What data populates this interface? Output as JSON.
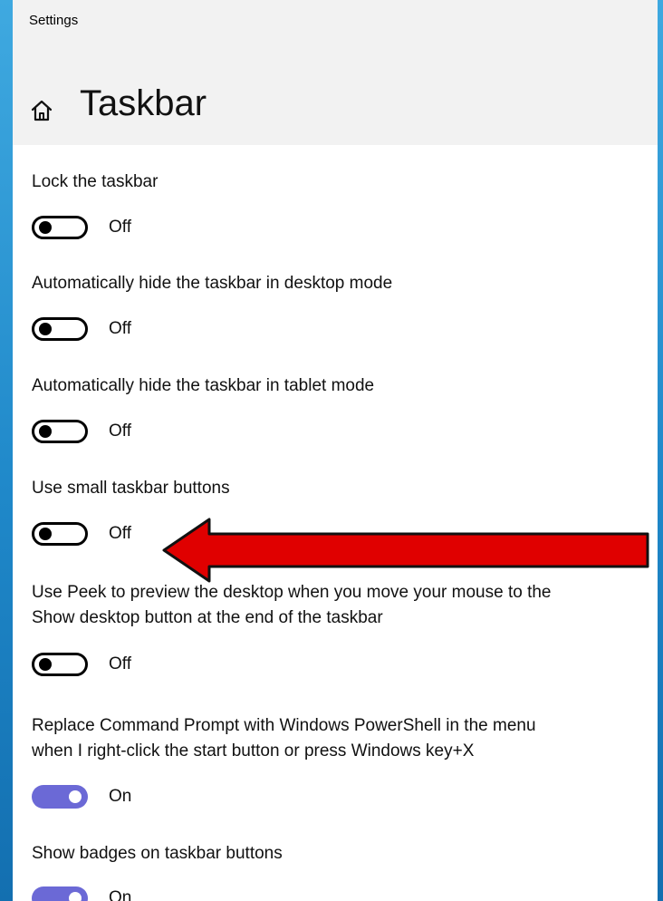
{
  "window": {
    "app_title": "Settings",
    "page_title": "Taskbar"
  },
  "header": {
    "home_icon": "home-icon"
  },
  "settings": [
    {
      "label": "Lock the taskbar",
      "state": "Off",
      "on": false
    },
    {
      "label": "Automatically hide the taskbar in desktop mode",
      "state": "Off",
      "on": false
    },
    {
      "label": "Automatically hide the taskbar in tablet mode",
      "state": "Off",
      "on": false
    },
    {
      "label": "Use small taskbar buttons",
      "state": "Off",
      "on": false
    },
    {
      "label": "Use Peek to preview the desktop when you move your mouse to the\nShow desktop button at the end of the taskbar",
      "state": "Off",
      "on": false
    },
    {
      "label": "Replace Command Prompt with Windows PowerShell in the menu\nwhen I right-click the start button or press Windows key+X",
      "state": "On",
      "on": true
    },
    {
      "label": "Show badges on taskbar buttons",
      "state": "On",
      "on": true
    }
  ],
  "annotation": {
    "arrow_color": "#e00000",
    "arrow_outline": "#111111"
  },
  "colors": {
    "toggle_on": "#6b69d6",
    "header_background": "#f2f2f2",
    "desktop_blue": "#1f88c9"
  }
}
